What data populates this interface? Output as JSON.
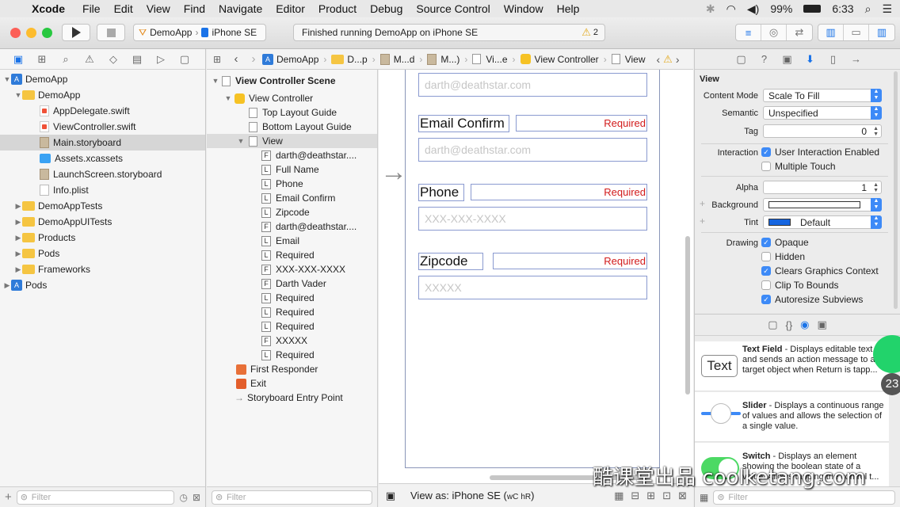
{
  "menubar": {
    "app": "Xcode",
    "items": [
      "File",
      "Edit",
      "View",
      "Find",
      "Navigate",
      "Editor",
      "Product",
      "Debug",
      "Source Control",
      "Window",
      "Help"
    ],
    "battery": "99%",
    "time": "6:33"
  },
  "toolbar": {
    "scheme_target": "DemoApp",
    "scheme_device": "iPhone SE",
    "status_text": "Finished running DemoApp on iPhone SE",
    "warning_count": "2"
  },
  "navigator": {
    "items": [
      {
        "label": "DemoApp"
      },
      {
        "label": "DemoApp"
      },
      {
        "label": "AppDelegate.swift"
      },
      {
        "label": "ViewController.swift"
      },
      {
        "label": "Main.storyboard"
      },
      {
        "label": "Assets.xcassets"
      },
      {
        "label": "LaunchScreen.storyboard"
      },
      {
        "label": "Info.plist"
      },
      {
        "label": "DemoAppTests"
      },
      {
        "label": "DemoAppUITests"
      },
      {
        "label": "Products"
      },
      {
        "label": "Pods"
      },
      {
        "label": "Frameworks"
      },
      {
        "label": "Pods"
      }
    ],
    "filter_placeholder": "Filter"
  },
  "jumpbar": {
    "items": [
      "DemoApp",
      "D...p",
      "M...d",
      "M...)",
      "Vi...e",
      "View Controller",
      "View"
    ]
  },
  "outline": {
    "scene": "View Controller Scene",
    "view_controller": "View Controller",
    "top_guide": "Top Layout Guide",
    "bottom_guide": "Bottom Layout Guide",
    "view": "View",
    "children": [
      {
        "type": "F",
        "label": "darth@deathstar...."
      },
      {
        "type": "L",
        "label": "Full Name"
      },
      {
        "type": "L",
        "label": "Phone"
      },
      {
        "type": "L",
        "label": "Email Confirm"
      },
      {
        "type": "L",
        "label": "Zipcode"
      },
      {
        "type": "F",
        "label": "darth@deathstar...."
      },
      {
        "type": "L",
        "label": "Email"
      },
      {
        "type": "L",
        "label": "Required"
      },
      {
        "type": "F",
        "label": "XXX-XXX-XXXX"
      },
      {
        "type": "F",
        "label": "Darth Vader"
      },
      {
        "type": "L",
        "label": "Required"
      },
      {
        "type": "L",
        "label": "Required"
      },
      {
        "type": "L",
        "label": "Required"
      },
      {
        "type": "F",
        "label": "XXXXX"
      },
      {
        "type": "L",
        "label": "Required"
      }
    ],
    "first_responder": "First Responder",
    "exit": "Exit",
    "entry_point": "Storyboard Entry Point",
    "filter_placeholder": "Filter"
  },
  "canvas": {
    "email_field_placeholder": "darth@deathstar.com",
    "email_confirm_label": "Email Confirm",
    "email_confirm_required": "Required",
    "email_confirm_placeholder": "darth@deathstar.com",
    "phone_label": "Phone",
    "phone_required": "Required",
    "phone_placeholder": "XXX-XXX-XXXX",
    "zip_label": "Zipcode",
    "zip_required": "Required",
    "zip_placeholder": "XXXXX",
    "view_as_prefix": "View as: iPhone SE (",
    "view_as_w": "wC",
    "view_as_h": "hR",
    "view_as_suffix": ")"
  },
  "inspector": {
    "section_title": "View",
    "content_mode_label": "Content Mode",
    "content_mode_value": "Scale To Fill",
    "semantic_label": "Semantic",
    "semantic_value": "Unspecified",
    "tag_label": "Tag",
    "tag_value": "0",
    "interaction_label": "Interaction",
    "user_interaction": "User Interaction Enabled",
    "multiple_touch": "Multiple Touch",
    "alpha_label": "Alpha",
    "alpha_value": "1",
    "background_label": "Background",
    "tint_label": "Tint",
    "tint_value": "Default",
    "drawing_label": "Drawing",
    "opaque": "Opaque",
    "hidden": "Hidden",
    "clears_graphics": "Clears Graphics Context",
    "clip_to_bounds": "Clip To Bounds",
    "autoresize": "Autoresize Subviews",
    "tint_color": "#1565e0",
    "accent_color": "#3d8af7"
  },
  "library": {
    "items": [
      {
        "icon_text": "Text",
        "title": "Text Field",
        "desc": " - Displays editable text and sends an action message to a target object when Return is tapp..."
      },
      {
        "title": "Slider",
        "desc": " - Displays a continuous range of values and allows the selection of a single value."
      },
      {
        "title": "Switch",
        "desc": " - Displays an element showing the boolean state of a value. Allows tapping the control t..."
      }
    ],
    "filter_placeholder": "Filter"
  },
  "overlay": {
    "badge_number": "23",
    "watermark": "酷课堂出品 coolketang.com"
  }
}
